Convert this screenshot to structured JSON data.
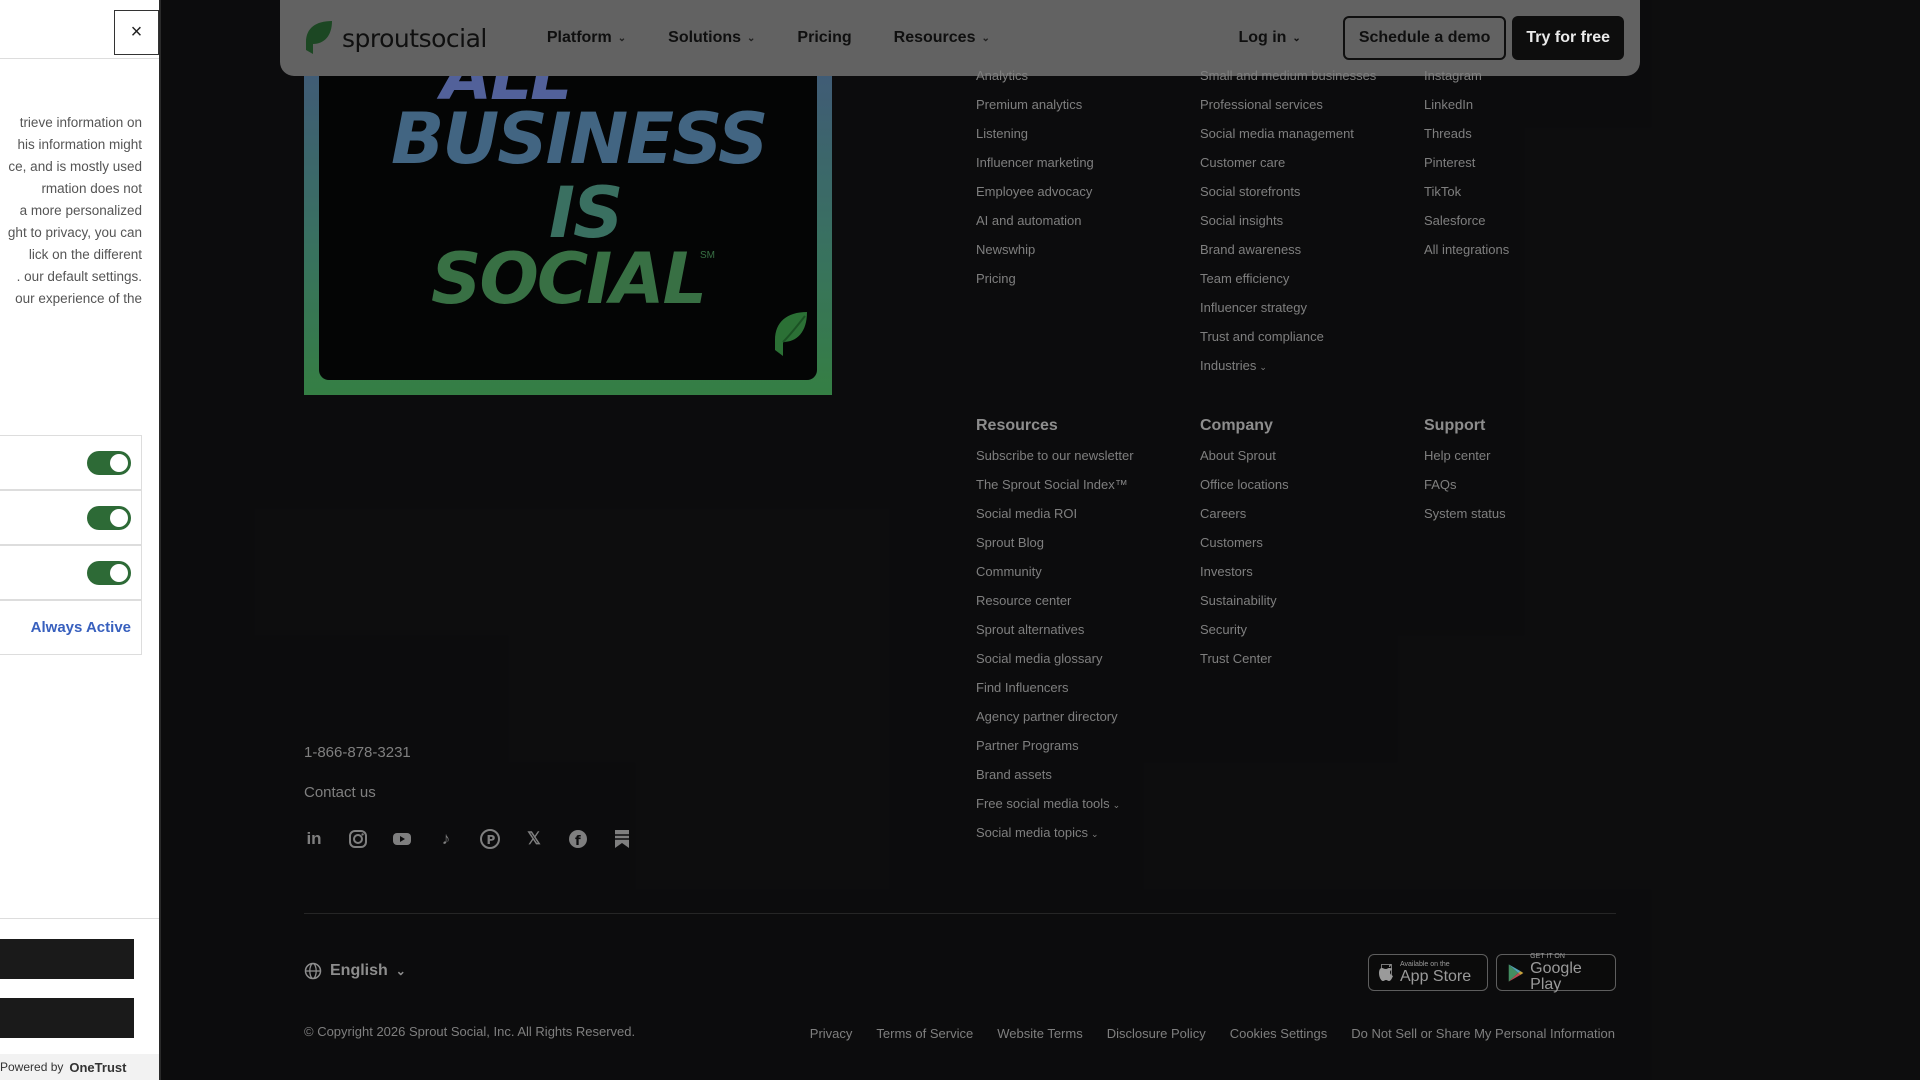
{
  "nav": {
    "logo_text": "sproutsocial",
    "items": [
      {
        "label": "Platform",
        "has_dropdown": true
      },
      {
        "label": "Solutions",
        "has_dropdown": true
      },
      {
        "label": "Pricing",
        "has_dropdown": false
      },
      {
        "label": "Resources",
        "has_dropdown": true
      }
    ],
    "login_label": "Log in",
    "demo_label": "Schedule a demo",
    "try_label": "Try for free"
  },
  "hero": {
    "line1": "ALL",
    "line2": "BUSINESS",
    "line3": "IS",
    "line4": "SOCIAL",
    "mark": "SM"
  },
  "footer": {
    "platform_links": [
      "Analytics",
      "Premium analytics",
      "Listening",
      "Influencer marketing",
      "Employee advocacy",
      "AI and automation",
      "Newswhip",
      "Pricing"
    ],
    "solutions_links": [
      "Small and medium businesses",
      "Professional services",
      "Social media management",
      "Customer care",
      "Social storefronts",
      "Social insights",
      "Brand awareness",
      "Team efficiency",
      "Influencer strategy",
      "Trust and compliance",
      "Industries"
    ],
    "integrations_links": [
      "Instagram",
      "LinkedIn",
      "Threads",
      "Pinterest",
      "TikTok",
      "Salesforce",
      "All integrations"
    ],
    "resources": {
      "title": "Resources",
      "links": [
        "Subscribe to our newsletter",
        "The Sprout Social Index™",
        "Social media ROI",
        "Sprout Blog",
        "Community",
        "Resource center",
        "Sprout alternatives",
        "Social media glossary",
        "Find Influencers",
        "Agency partner directory",
        "Partner Programs",
        "Brand assets",
        "Free social media tools",
        "Social media topics"
      ]
    },
    "company": {
      "title": "Company",
      "links": [
        "About Sprout",
        "Office locations",
        "Careers",
        "Customers",
        "Investors",
        "Sustainability",
        "Security",
        "Trust Center"
      ]
    },
    "support": {
      "title": "Support",
      "links": [
        "Help center",
        "FAQs",
        "System status"
      ]
    },
    "phone": "1-866-878-3231",
    "contact": "Contact us",
    "social_icons": [
      "linkedin-icon",
      "instagram-icon",
      "youtube-icon",
      "tiktok-icon",
      "pinterest-icon",
      "x-icon",
      "facebook-icon",
      "bookmark-icon"
    ],
    "language": "English",
    "copyright": "© Copyright 2026 Sprout Social, Inc. All Rights Reserved.",
    "legal_links": [
      "Privacy",
      "Terms of Service",
      "Website Terms",
      "Disclosure Policy",
      "Cookies Settings",
      "Do Not Sell or Share My Personal Information"
    ],
    "appstore": {
      "small": "Available on the",
      "big": "App Store"
    },
    "googleplay": {
      "small": "GET IT ON",
      "big": "Google Play"
    }
  },
  "cookie_panel": {
    "close_label": "×",
    "text_lines": [
      "trieve information on",
      "his information might",
      "ce, and is mostly used",
      "rmation does not",
      "a more personalized",
      "ght to privacy, you can",
      "lick on the different",
      ". our default settings.",
      "our experience of the"
    ],
    "always_active": "Always Active",
    "powered_by": "Powered by",
    "powered_brand": "OneTrust"
  },
  "colors": {
    "toggle_on": "#2d6a36",
    "always_active": "#3860be",
    "nav_bg": "#6b6b6b"
  }
}
